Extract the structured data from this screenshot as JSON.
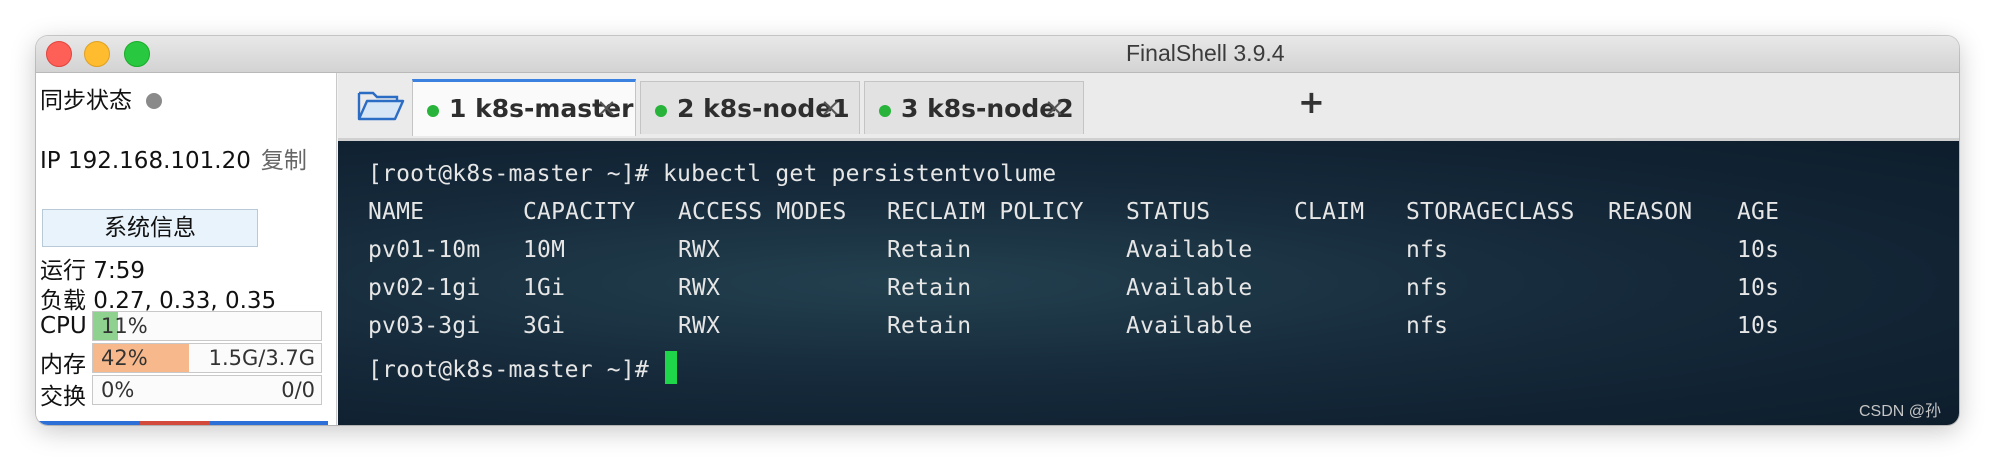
{
  "window": {
    "title": "FinalShell 3.9.4"
  },
  "sidebar": {
    "sync_label": "同步状态",
    "ip_label": "IP 192.168.101.20",
    "copy_label": "复制",
    "sysinfo_button": "系统信息",
    "uptime": "运行 7:59",
    "load": "负载 0.27, 0.33, 0.35",
    "cpu": {
      "label": "CPU",
      "value": "11%",
      "percent": 11
    },
    "memory": {
      "label": "内存",
      "percent_text": "42%",
      "usage": "1.5G/3.7G",
      "percent": 42
    },
    "swap": {
      "label": "交换",
      "percent_text": "0%",
      "usage": "0/0",
      "percent": 0
    }
  },
  "tabs": [
    {
      "label": "1 k8s-master",
      "active": true,
      "status_color": "#28b33a"
    },
    {
      "label": "2 k8s-node1",
      "active": false,
      "status_color": "#28b33a"
    },
    {
      "label": "3 k8s-node2",
      "active": false,
      "status_color": "#28b33a"
    }
  ],
  "tab_close_glyph": "×",
  "add_tab_glyph": "+",
  "terminal": {
    "command_line": "[root@k8s-master ~]# kubectl get persistentvolume",
    "headers": [
      "NAME",
      "CAPACITY",
      "ACCESS MODES",
      "RECLAIM POLICY",
      "STATUS",
      "CLAIM",
      "STORAGECLASS",
      "REASON",
      "AGE"
    ],
    "rows": [
      [
        "pv01-10m",
        "10M",
        "RWX",
        "Retain",
        "Available",
        "",
        "nfs",
        "",
        "10s"
      ],
      [
        "pv02-1gi",
        "1Gi",
        "RWX",
        "Retain",
        "Available",
        "",
        "nfs",
        "",
        "10s"
      ],
      [
        "pv03-3gi",
        "3Gi",
        "RWX",
        "Retain",
        "Available",
        "",
        "nfs",
        "",
        "10s"
      ]
    ],
    "prompt": "[root@k8s-master ~]# "
  },
  "watermark": "CSDN @孙",
  "colors": {
    "accent": "#3b82e0",
    "cursor": "#1fd54a",
    "cpu_bar": "#8fd18f",
    "mem_bar": "#f7b98c"
  }
}
